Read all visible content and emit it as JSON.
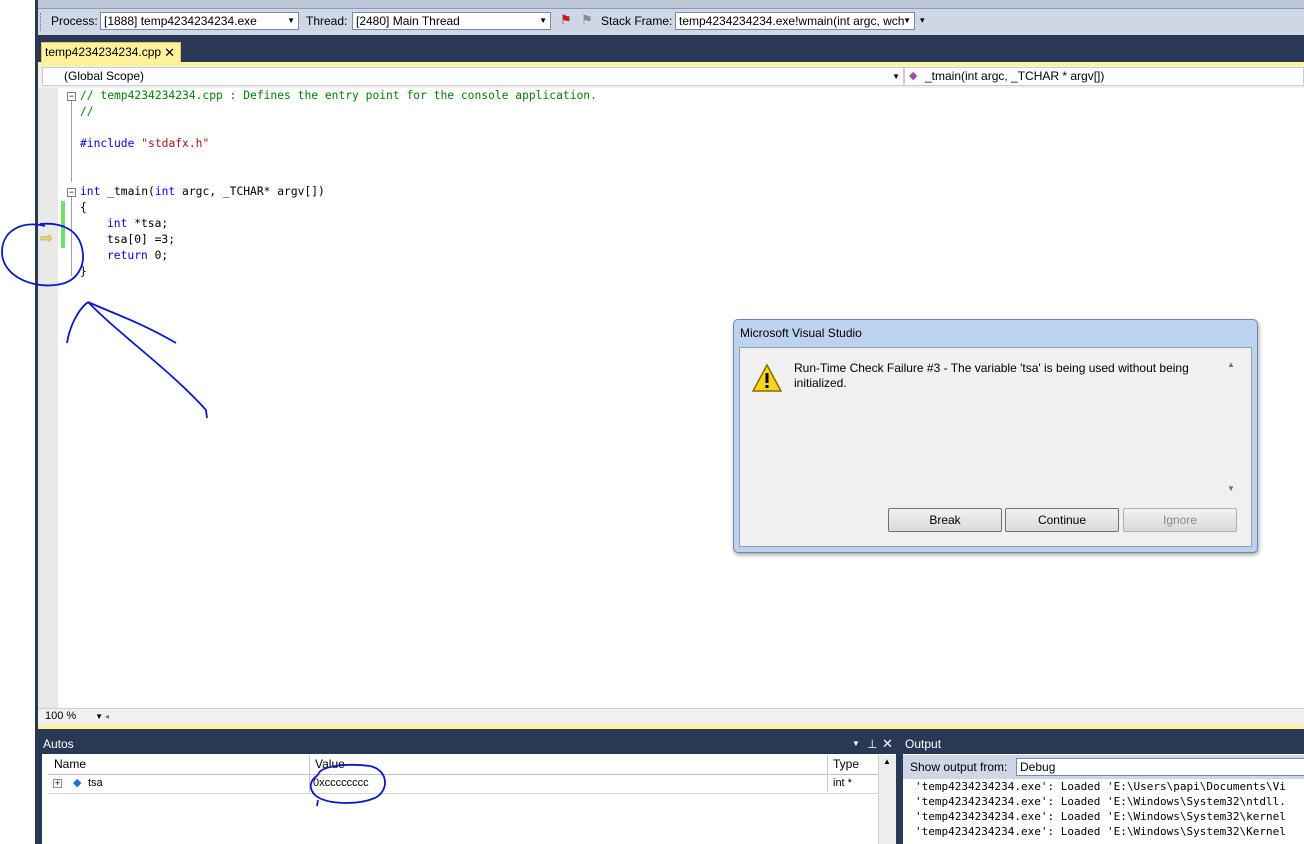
{
  "debug_toolbar": {
    "process_label": "Process:",
    "process_value": "[1888] temp4234234234.exe",
    "thread_label": "Thread:",
    "thread_value": "[2480] Main Thread",
    "stack_frame_label": "Stack Frame:",
    "stack_frame_value": "temp4234234234.exe!wmain(int argc, wch"
  },
  "document_tab": {
    "label": "temp4234234234.cpp",
    "close": "✕"
  },
  "nav_bar": {
    "scope": "(Global Scope)",
    "member": "_tmain(int argc, _TCHAR * argv[])"
  },
  "code": {
    "line1_comment": "// temp4234234234.cpp : Defines the entry point for the console application.",
    "line2_comment": "//",
    "line4_include_kw": "#include",
    "line4_include_file": "\"stdafx.h\"",
    "line7_kw": "int",
    "line7_rest": " _tmain(",
    "line7_kw2": "int",
    "line7_rest2": " argc, _TCHAR* argv[])",
    "line8": "{",
    "line9_kw": "int",
    "line9_rest": " *tsa;",
    "line10": "tsa[0] =3;",
    "line11_kw": "return",
    "line11_rest": " 0;",
    "line12": "}"
  },
  "zoom": {
    "value": "100 %"
  },
  "autos": {
    "title": "Autos",
    "columns": [
      "Name",
      "Value",
      "Type"
    ],
    "rows": [
      {
        "name": "tsa",
        "value": "0xcccccccc",
        "type": "int *"
      }
    ]
  },
  "output": {
    "title": "Output",
    "show_from_label": "Show output from:",
    "show_from_value": "Debug",
    "lines": [
      "'temp4234234234.exe': Loaded 'E:\\Users\\papi\\Documents\\Vi",
      "'temp4234234234.exe': Loaded 'E:\\Windows\\System32\\ntdll.",
      "'temp4234234234.exe': Loaded 'E:\\Windows\\System32\\kernel",
      "'temp4234234234.exe': Loaded 'E:\\Windows\\System32\\Kernel"
    ]
  },
  "dialog": {
    "title": "Microsoft Visual Studio",
    "message": "Run-Time Check Failure #3 - The variable 'tsa' is being used without being initialized.",
    "break_label": "Break",
    "continue_label": "Continue",
    "ignore_label": "Ignore"
  },
  "colors": {
    "accent_frame": "#293955",
    "tab_active": "#fff29d",
    "annotation_ink": "#0a18c8"
  }
}
